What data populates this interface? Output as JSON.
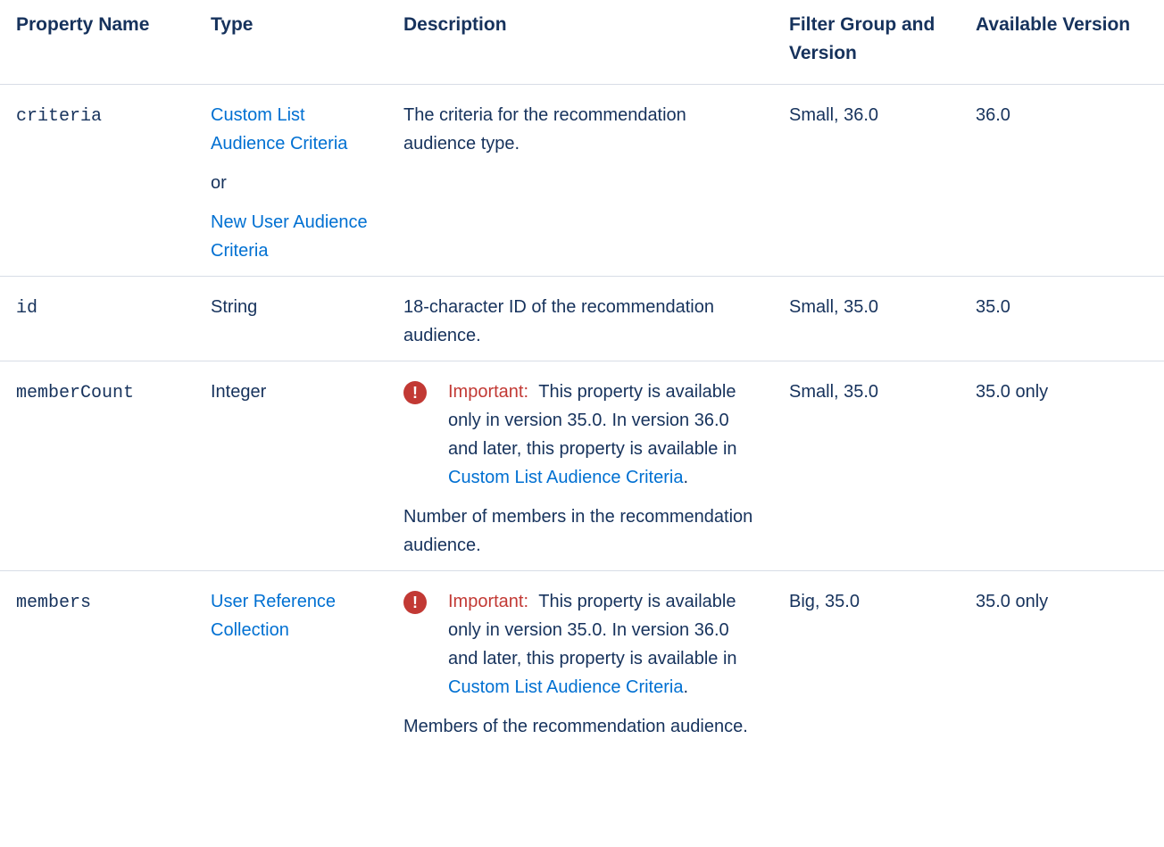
{
  "headers": {
    "property_name": "Property Name",
    "type": "Type",
    "description": "Description",
    "filter_group": "Filter Group and Version",
    "available_version": "Available Version"
  },
  "rows": [
    {
      "name": "criteria",
      "type_link1": "Custom List Audience Criteria",
      "type_or": "or",
      "type_link2": "New User Audience Criteria",
      "description": "The criteria for the recommendation audience type.",
      "filter": "Small, 36.0",
      "version": "36.0"
    },
    {
      "name": "id",
      "type": "String",
      "description": "18-character ID of the recommendation audience.",
      "filter": "Small, 35.0",
      "version": "35.0"
    },
    {
      "name": "memberCount",
      "type": "Integer",
      "important_label": "Important:",
      "important_text": "This property is available only in version 35.0. In version 36.0 and later, this property is available in",
      "important_link": "Custom List Audience Criteria",
      "important_end": ".",
      "description": "Number of members in the recommendation audience.",
      "filter": "Small, 35.0",
      "version": "35.0 only"
    },
    {
      "name": "members",
      "type_link1": "User Reference Collection",
      "important_label": "Important:",
      "important_text": "This property is available only in version 35.0. In version 36.0 and later, this property is available in",
      "important_link": "Custom List Audience Criteria",
      "important_end": ".",
      "description": "Members of the recommendation audience.",
      "filter": "Big, 35.0",
      "version": "35.0 only"
    }
  ],
  "icons": {
    "important": "exclamation-circle-icon",
    "important_glyph": "!"
  },
  "colors": {
    "text": "#16325c",
    "link": "#0070d2",
    "important": "#c23934",
    "border": "#d8dde6"
  }
}
